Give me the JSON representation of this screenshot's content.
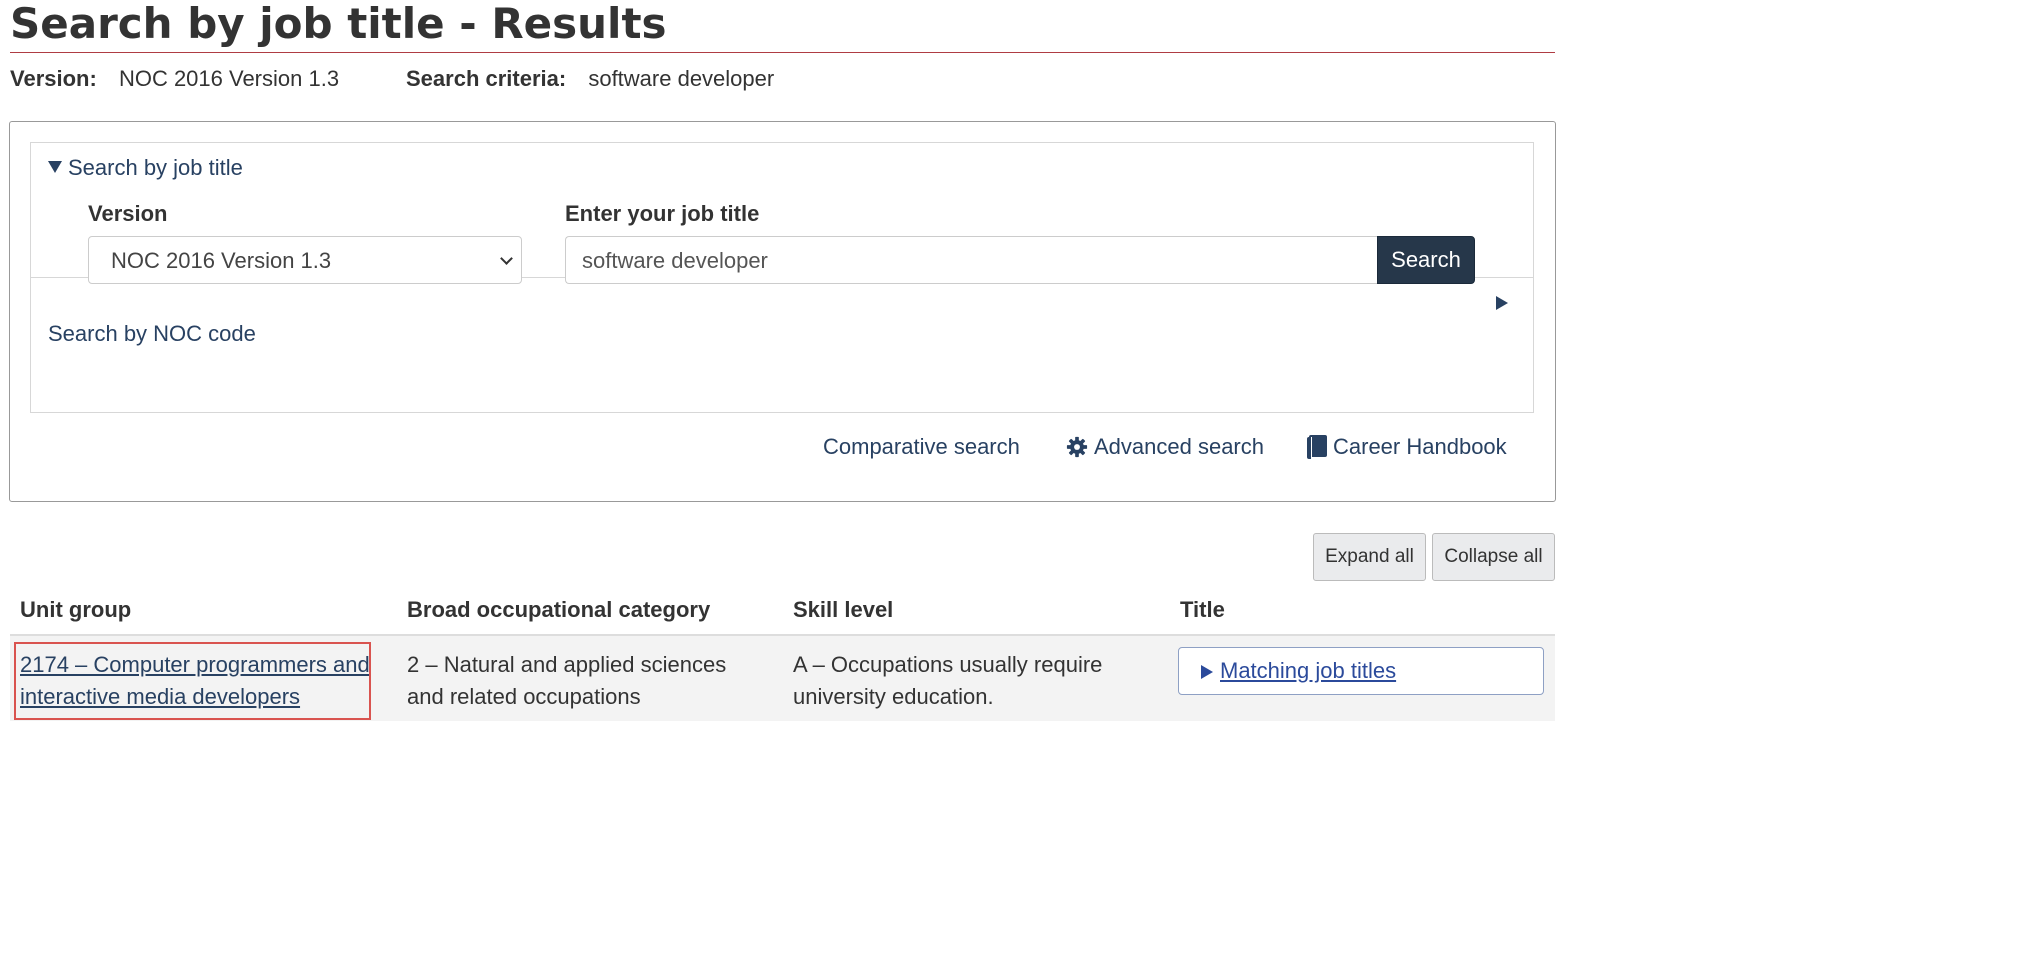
{
  "page": {
    "title": "Search by job title - Results",
    "version_label": "Version:",
    "version_value": "NOC 2016 Version 1.3",
    "criteria_label": "Search criteria:",
    "criteria_value": "software developer"
  },
  "search_panel": {
    "summary": "Search by job title",
    "version_field_label": "Version",
    "version_selected": "NOC 2016 Version 1.3",
    "job_field_label": "Enter your job title",
    "job_value": "software developer",
    "search_button": "Search",
    "noc_code_link": "Search by NOC code"
  },
  "tools": {
    "comparative": "Comparative search",
    "advanced": "Advanced search",
    "handbook": "Career Handbook"
  },
  "results": {
    "expand_all": "Expand all",
    "collapse_all": "Collapse all",
    "columns": [
      "Unit group",
      "Broad occupational category",
      "Skill level",
      "Title"
    ],
    "rows": [
      {
        "unit_group": "2174 – Computer programmers and interactive media developers",
        "broad_category": "2 – Natural and applied sciences and related occupations",
        "skill_level": "A – Occupations usually require university education.",
        "title_link": "Matching job titles"
      }
    ]
  },
  "colors": {
    "link": "#284162",
    "search_button_bg": "#26374a",
    "title_rule": "#af3c43",
    "highlight": "#d9534f"
  }
}
